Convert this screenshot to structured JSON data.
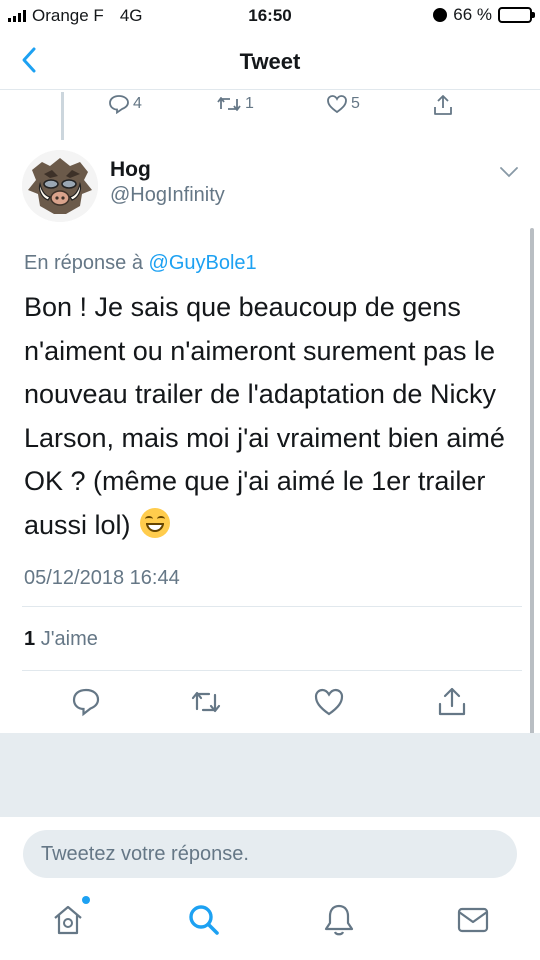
{
  "status_bar": {
    "carrier": "Orange F",
    "network": "4G",
    "time": "16:50",
    "battery": "66 %",
    "battery_level": 0.66
  },
  "nav": {
    "title": "Tweet"
  },
  "previous_tweet_stats": {
    "replies": "4",
    "retweets": "1",
    "likes": "5"
  },
  "tweet": {
    "author_name": "Hog",
    "author_handle": "@HogInfinity",
    "reply_prefix": "En réponse à",
    "reply_mention": "@GuyBole1",
    "text": "Bon ! Je sais que beaucoup de gens n'aiment ou n'aimeront surement pas le nouveau trailer de l'adaptation de Nicky Larson, mais moi j'ai vraiment bien aimé OK ? (même que j'ai aimé le 1er trailer aussi lol)",
    "emoji": "grinning-face",
    "timestamp": "05/12/2018 16:44",
    "likes_count": "1",
    "likes_label": "J'aime"
  },
  "composer": {
    "placeholder": "Tweetez votre réponse."
  },
  "colors": {
    "accent": "#1da1f2",
    "muted": "#657786",
    "divider": "#e1e8ed",
    "gray_bg": "#e6ecf0"
  },
  "tab_bar": {
    "icons": [
      "home-icon",
      "search-icon",
      "notifications-icon",
      "messages-icon"
    ]
  }
}
